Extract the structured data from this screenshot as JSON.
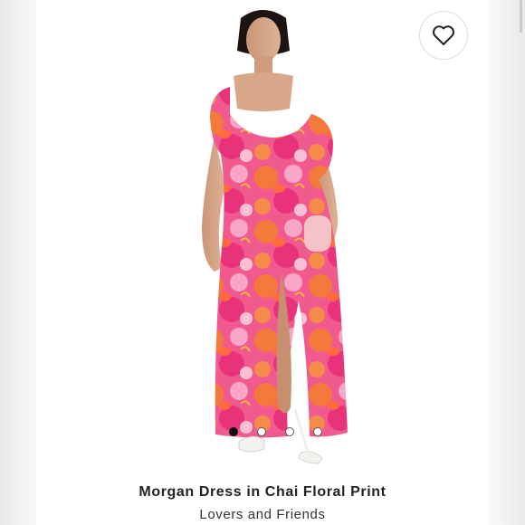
{
  "product": {
    "title": "Morgan Dress in Chai Floral Print",
    "brand": "Lovers and Friends",
    "image_alt": "Model wearing a pink and orange floral maxi dress with puff sleeves and a front slit",
    "favorite_icon": "heart-icon",
    "gallery": {
      "count": 4,
      "active_index": 0
    }
  },
  "colors": {
    "dress_pink": "#e9448c",
    "dress_orange": "#f26a3a",
    "dress_light_pink": "#f4a8c8",
    "text": "#222222"
  }
}
